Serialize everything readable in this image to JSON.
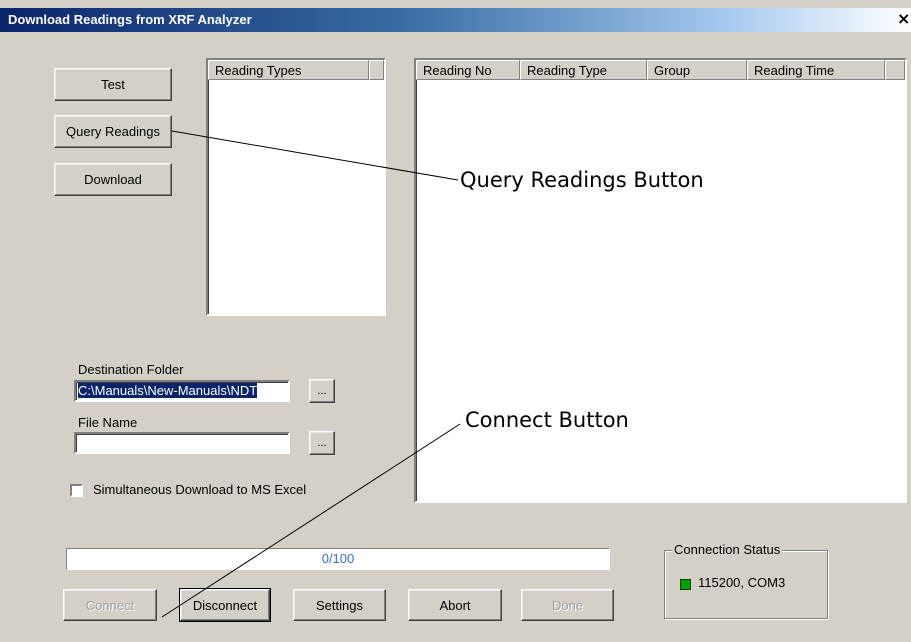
{
  "window": {
    "title": "Download Readings from XRF Analyzer",
    "close_glyph": "×"
  },
  "buttons": {
    "test": "Test",
    "query_readings": "Query Readings",
    "download": "Download",
    "connect": "Connect",
    "disconnect": "Disconnect",
    "settings": "Settings",
    "abort": "Abort",
    "done": "Done",
    "browse": "..."
  },
  "reading_types": {
    "header": "Reading Types"
  },
  "readings_table": {
    "columns": [
      "Reading No",
      "Reading Type",
      "Group",
      "Reading Time"
    ]
  },
  "destination": {
    "label": "Destination Folder",
    "value": "C:\\Manuals\\New-Manuals\\NDT"
  },
  "file_name": {
    "label": "File Name",
    "value": ""
  },
  "excel_option": {
    "label": "Simultaneous Download to MS Excel",
    "checked": false
  },
  "progress": {
    "text": "0/100",
    "value": 0
  },
  "connection": {
    "legend": "Connection Status",
    "status": "115200, COM3",
    "indicator_color": "#00a000"
  },
  "annotations": {
    "query_button_callout": "Query Readings Button",
    "connect_button_callout": "Connect Button"
  }
}
